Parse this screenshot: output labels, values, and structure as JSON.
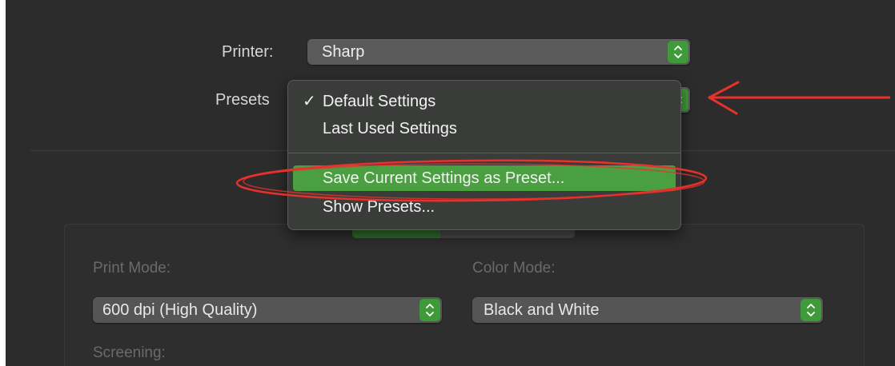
{
  "printer": {
    "label": "Printer:",
    "value": "Sharp"
  },
  "presets": {
    "label": "Presets",
    "menu": [
      {
        "label": "Default Settings",
        "checked": true
      },
      {
        "label": "Last Used Settings",
        "checked": false
      },
      {
        "label": "Save Current Settings as Preset...",
        "checked": false,
        "highlighted": true
      },
      {
        "label": "Show Presets...",
        "checked": false
      }
    ],
    "check_glyph": "✓"
  },
  "settings_panel": {
    "print_mode_label": "Print Mode:",
    "print_mode_value": "600 dpi (High Quality)",
    "color_mode_label": "Color Mode:",
    "color_mode_value": "Black and White",
    "screening_label": "Screening:"
  },
  "icons": {
    "popup_stepper": "chevron-up-down-icon",
    "annotation_arrow": "red-arrow-icon",
    "annotation_ellipse": "red-ellipse-annotation"
  },
  "colors": {
    "accent_green": "#4aa040",
    "background": "#2c2c2c",
    "annotation_red": "#e8312c"
  }
}
